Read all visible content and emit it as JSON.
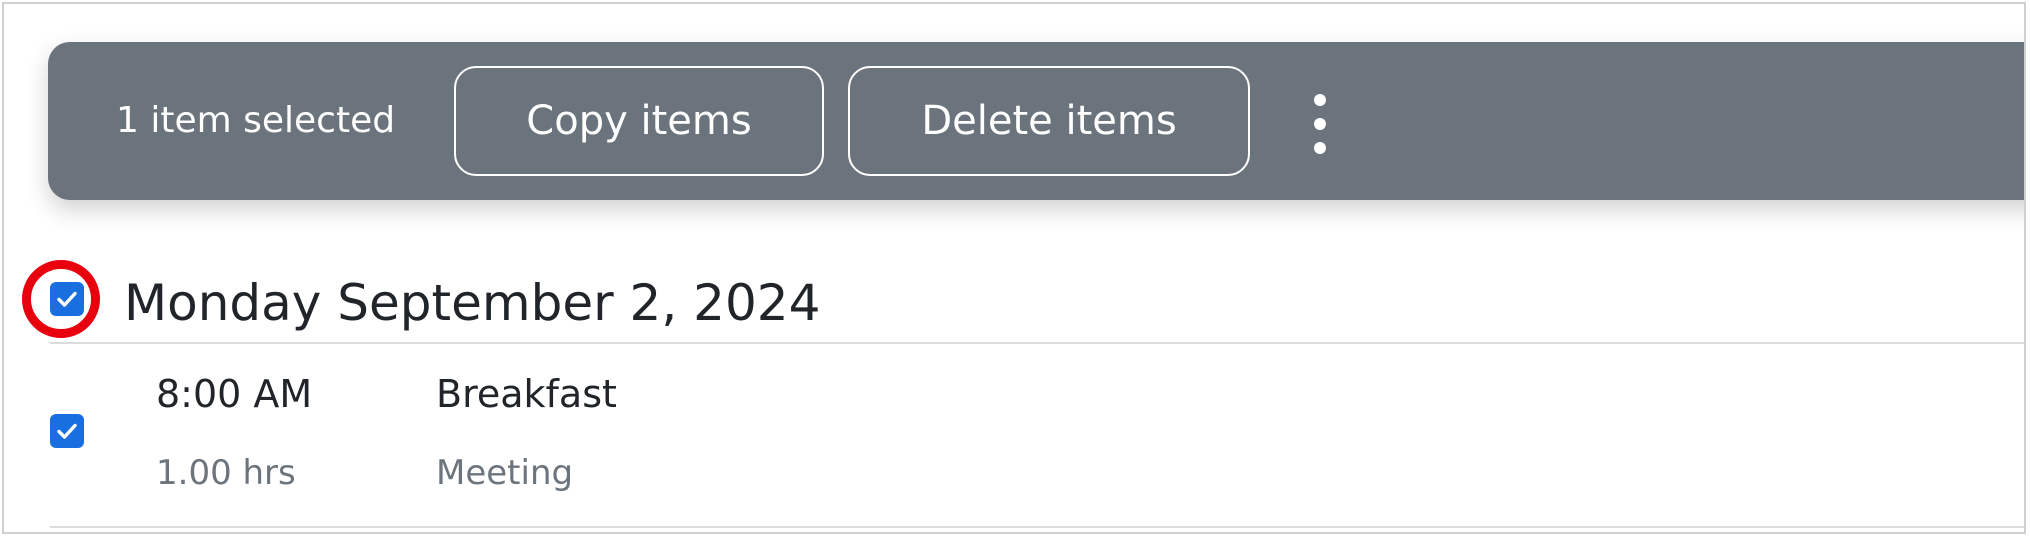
{
  "toolbar": {
    "selected_count_text": "1 item selected",
    "copy_label": "Copy items",
    "delete_label": "Delete items",
    "more_icon": "more-vertical-icon"
  },
  "agenda": {
    "day_title": "Monday September 2, 2024",
    "day_checked": true,
    "events": [
      {
        "time": "8:00 AM",
        "duration": "1.00 hrs",
        "name": "Breakfast",
        "type": "Meeting",
        "checked": true
      }
    ]
  },
  "colors": {
    "toolbar_bg": "#6b737c",
    "checkbox_blue": "#1a6fe0",
    "highlight_red": "#e8000f",
    "secondary_text": "#6c757d"
  }
}
